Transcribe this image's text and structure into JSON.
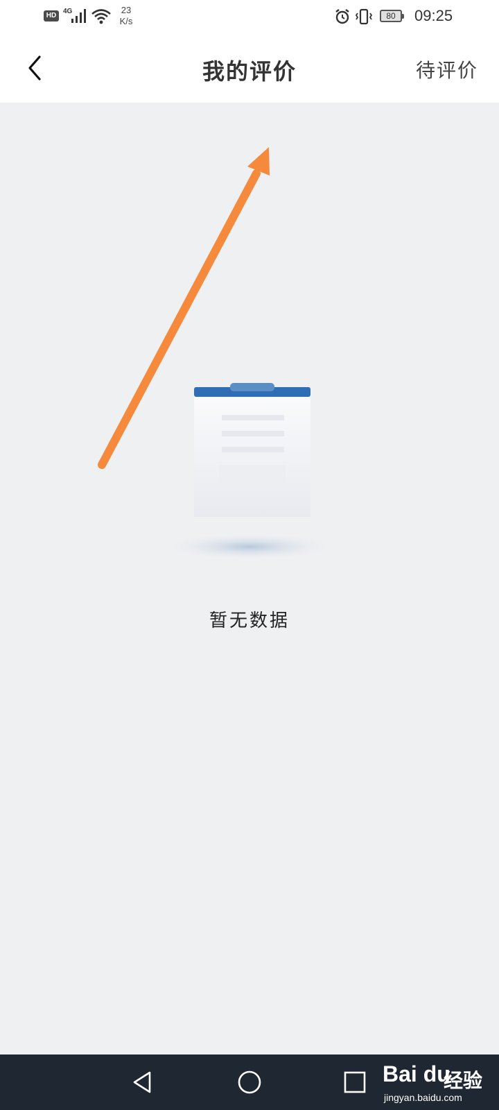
{
  "status_bar": {
    "hd_label": "HD",
    "network_label": "4G",
    "speed_value": "23",
    "speed_unit": "K/s",
    "battery_level": "80",
    "time": "09:25",
    "icons": [
      "hd-icon",
      "signal-icon",
      "wifi-icon",
      "alarm-icon",
      "vibrate-icon",
      "battery-icon"
    ]
  },
  "header": {
    "back_icon": "chevron-left-icon",
    "title": "我的评价",
    "action_label": "待评价"
  },
  "empty_state": {
    "illustration": "empty-document-icon",
    "message": "暂无数据"
  },
  "annotation": {
    "type": "arrow",
    "color": "#f58a3c"
  },
  "nav_bar": {
    "back_icon": "triangle-back-icon",
    "home_icon": "circle-home-icon",
    "recents_icon": "square-recents-icon"
  },
  "watermark": {
    "logo_text": "Bai du",
    "suffix": "经验",
    "url": "jingyan.baidu.com"
  },
  "colors": {
    "background": "#eff0f2",
    "header_bg": "#ffffff",
    "navbar_bg": "#1f2733",
    "doc_accent": "#2f6db5"
  }
}
